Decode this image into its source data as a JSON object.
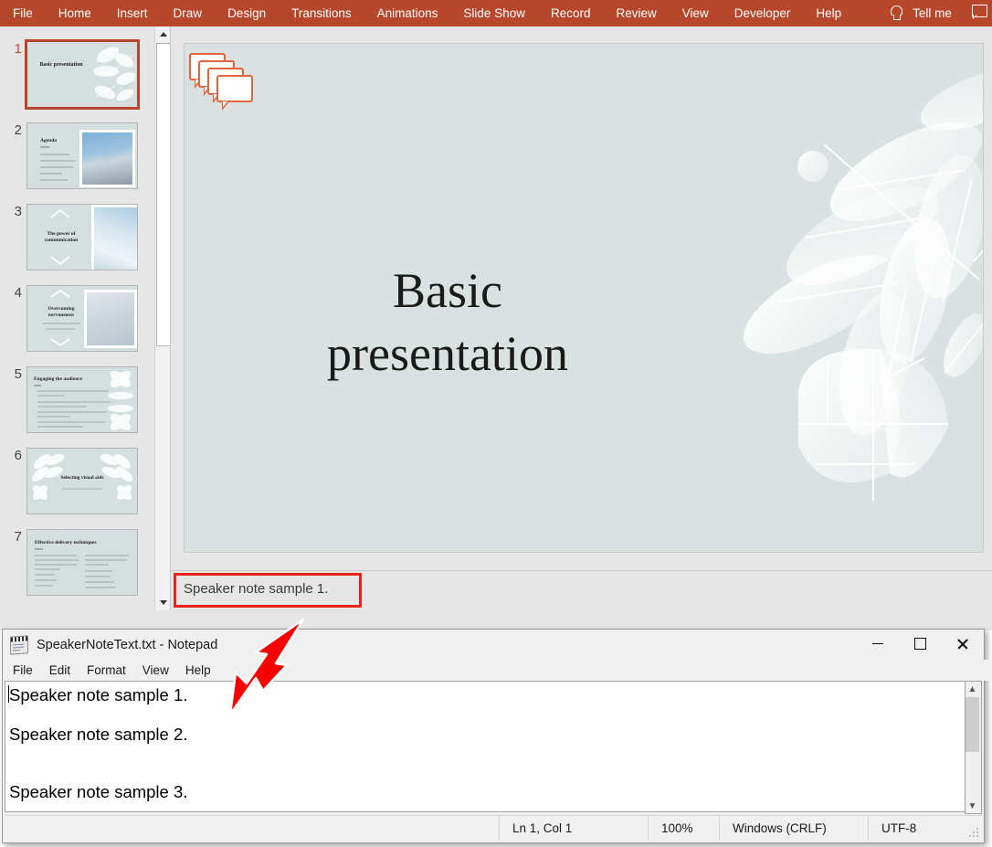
{
  "app": {
    "ribbon": {
      "tabs": [
        "File",
        "Home",
        "Insert",
        "Draw",
        "Design",
        "Transitions",
        "Animations",
        "Slide Show",
        "Record",
        "Review",
        "View",
        "Developer",
        "Help"
      ],
      "tell_me": "Tell me",
      "bulb_icon": "lightbulb-icon",
      "comment_icon": "comment-icon",
      "accent_color": "#b7472a"
    },
    "thumbnails": {
      "selected": 1,
      "slides": [
        {
          "number": "1",
          "title": "Basic presentation",
          "type": "title-leaves"
        },
        {
          "number": "2",
          "title": "Agenda",
          "type": "text-photo"
        },
        {
          "number": "3",
          "title": "The power of communication",
          "type": "text-photo"
        },
        {
          "number": "4",
          "title": "Overcoming nervousness",
          "type": "text-photo"
        },
        {
          "number": "5",
          "title": "Engaging the audience",
          "type": "bullets-leaves"
        },
        {
          "number": "6",
          "title": "Selecting visual aids",
          "type": "section-leaves"
        },
        {
          "number": "7",
          "title": "Effective delivery techniques",
          "type": "two-column"
        }
      ]
    },
    "slide": {
      "title_line1": "Basic",
      "title_line2": "presentation",
      "background_color": "#dae1e1",
      "comment_icon": "comment-bubbles-icon",
      "comment_color": "#e2643c"
    },
    "notes": {
      "text": "Speaker note sample 1.",
      "highlight_color": "#e8241b"
    }
  },
  "notepad": {
    "title": "SpeakerNoteText.txt - Notepad",
    "icon": "notepad-icon",
    "menu": [
      "File",
      "Edit",
      "Format",
      "View",
      "Help"
    ],
    "window_buttons": {
      "minimize": "minimize-icon",
      "maximize": "maximize-icon",
      "close": "close-icon"
    },
    "content_lines": [
      "Speaker note sample 1.",
      "Speaker note sample 2.",
      "Speaker note sample 3."
    ],
    "status": {
      "position": "Ln 1, Col 1",
      "zoom": "100%",
      "line_ending": "Windows (CRLF)",
      "encoding": "UTF-8"
    }
  },
  "annotation": {
    "arrow_color": "#f80000",
    "arrow_name": "red-pointer-arrow"
  }
}
